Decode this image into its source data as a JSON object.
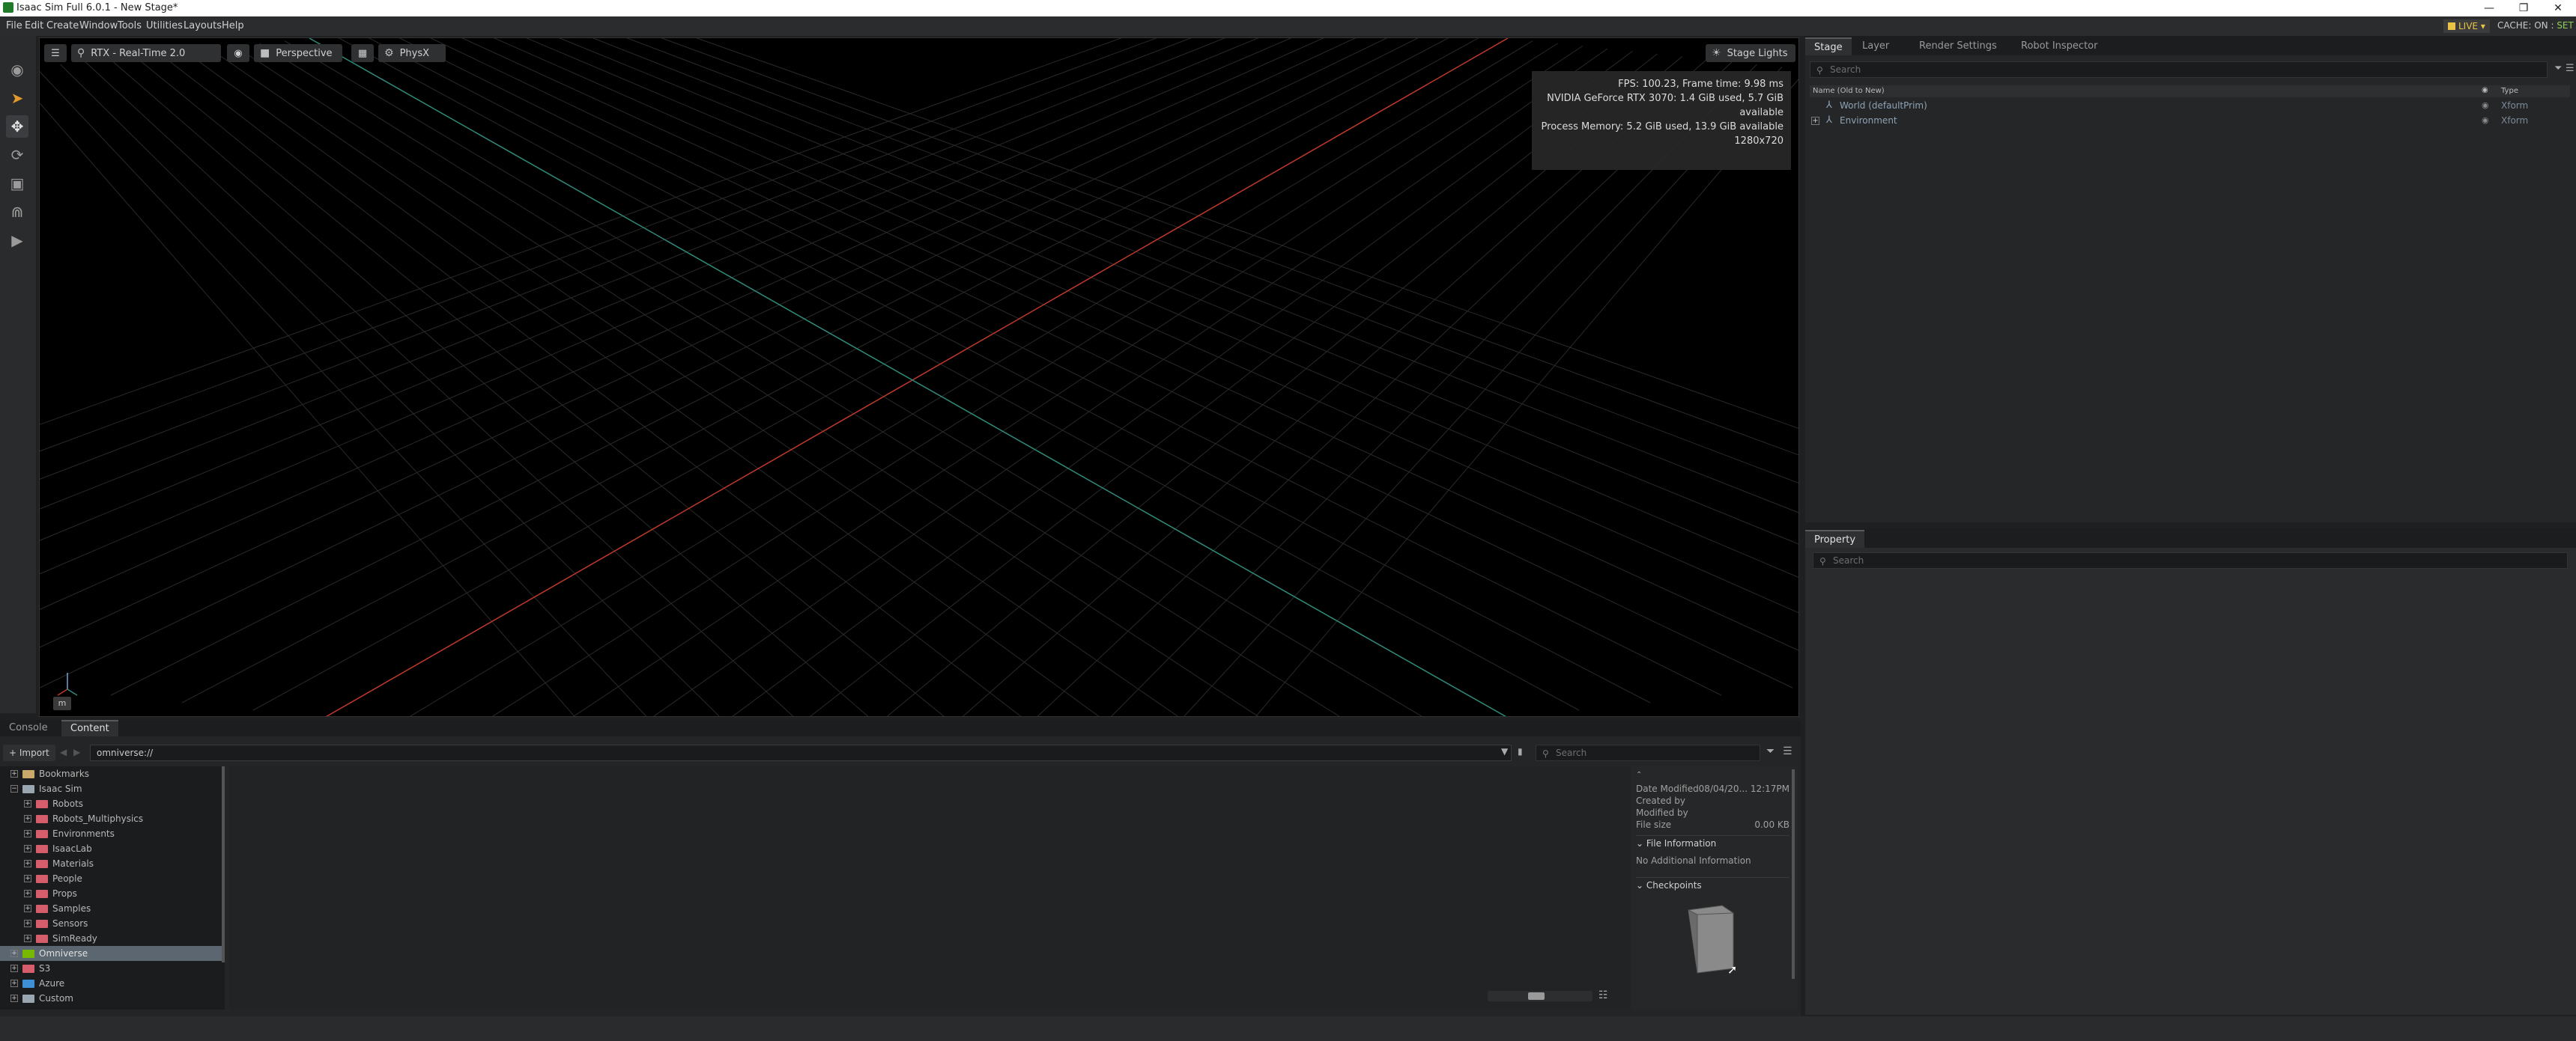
{
  "window": {
    "title": "Isaac Sim Full 6.0.1 - New Stage*",
    "minimize": "—",
    "maximize": "❐",
    "close": "✕"
  },
  "menu": [
    "File",
    "Edit",
    "Create",
    "Window",
    "Tools",
    "Utilities",
    "Layouts",
    "Help"
  ],
  "status": {
    "live": "LIVE",
    "cache_label": "CACHE: ON",
    "cache_set": "SET"
  },
  "viewport": {
    "renderer": "RTX - Real-Time 2.0",
    "camera": "Perspective",
    "physics": "PhysX",
    "stage_lights": "Stage Lights",
    "stats": [
      "FPS: 100.23, Frame time: 9.98 ms",
      "NVIDIA GeForce RTX 3070: 1.4 GiB used, 5.7 GiB available",
      "Process Memory: 5.2 GiB used, 13.9 GiB available",
      "1280x720"
    ],
    "units": "m"
  },
  "stage": {
    "tabs": [
      "Stage",
      "Layer",
      "Render Settings",
      "Robot Inspector"
    ],
    "active_tab": "Stage",
    "search_placeholder": "Search",
    "col_name": "Name (Old to New)",
    "col_type": "Type",
    "rows": [
      {
        "name": "World (defaultPrim)",
        "type": "Xform",
        "expandable": false
      },
      {
        "name": "Environment",
        "type": "Xform",
        "expandable": true
      }
    ]
  },
  "property": {
    "tab": "Property",
    "search_placeholder": "Search"
  },
  "content": {
    "tabs": [
      "Console",
      "Content"
    ],
    "active_tab": "Content",
    "import_label": "Import",
    "path": "omniverse://",
    "search_placeholder": "Search",
    "tree": [
      {
        "label": "Bookmarks",
        "level": 0,
        "icon": "bookmark"
      },
      {
        "label": "Isaac Sim",
        "level": 0,
        "icon": "cloud",
        "expanded": true
      },
      {
        "label": "Robots",
        "level": 1,
        "icon": "folder"
      },
      {
        "label": "Robots_Multiphysics",
        "level": 1,
        "icon": "folder"
      },
      {
        "label": "Environments",
        "level": 1,
        "icon": "folder"
      },
      {
        "label": "IsaacLab",
        "level": 1,
        "icon": "folder"
      },
      {
        "label": "Materials",
        "level": 1,
        "icon": "folder"
      },
      {
        "label": "People",
        "level": 1,
        "icon": "folder"
      },
      {
        "label": "Props",
        "level": 1,
        "icon": "folder"
      },
      {
        "label": "Samples",
        "level": 1,
        "icon": "folder"
      },
      {
        "label": "Sensors",
        "level": 1,
        "icon": "folder"
      },
      {
        "label": "SimReady",
        "level": 1,
        "icon": "folder"
      },
      {
        "label": "Omniverse",
        "level": 0,
        "icon": "omniverse",
        "selected": true
      },
      {
        "label": "S3",
        "level": 0,
        "icon": "s3"
      },
      {
        "label": "Azure",
        "level": 0,
        "icon": "azure"
      },
      {
        "label": "Custom",
        "level": 0,
        "icon": "cloud"
      }
    ],
    "details": {
      "date_modified_label": "Date Modified",
      "date_modified": "08/04/20... 12:17PM",
      "created_by_label": "Created by",
      "modified_by_label": "Modified by",
      "file_size_label": "File size",
      "file_size": "0.00 KB",
      "file_info_header": "File Information",
      "file_info_text": "No Additional Information",
      "checkpoints_header": "Checkpoints"
    }
  },
  "colors": {
    "x_axis": "#c0392b",
    "z_axis": "#2e8b7a",
    "grid": "#2a2a2a",
    "accent": "#e8c547"
  }
}
